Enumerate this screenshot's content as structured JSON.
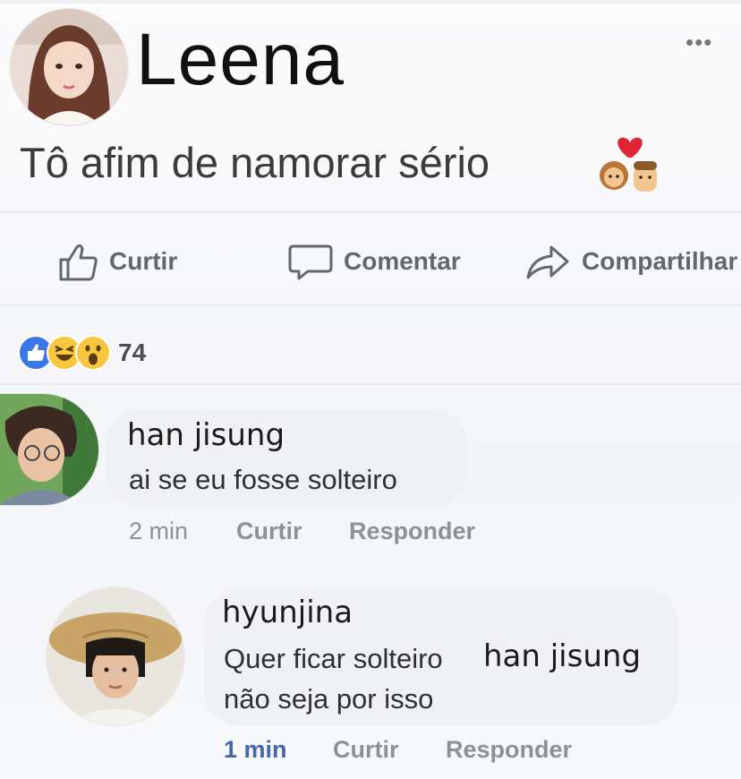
{
  "post": {
    "author_name": "Leena",
    "menu_icon": "more-options-icon",
    "menu_glyph": "•••",
    "text": "Tô afim de namorar sério",
    "emoji": "couple-with-heart"
  },
  "actions": {
    "like_label": "Curtir",
    "comment_label": "Comentar",
    "share_label": "Compartilhar"
  },
  "reactions": {
    "icons": [
      "like",
      "haha",
      "wow"
    ],
    "count": "74"
  },
  "comments": [
    {
      "author": "han jisung",
      "text": "ai se eu fosse solteiro",
      "time": "2 min",
      "like_label": "Curtir",
      "reply_label": "Responder"
    },
    {
      "author": "hyunjina",
      "text_line1": "Quer ficar solteiro",
      "mention": "han jisung",
      "text_line2": "não seja por isso",
      "time": "1 min",
      "like_label": "Curtir",
      "reply_label": "Responder"
    }
  ],
  "colors": {
    "action_text": "#64676b",
    "bubble": "#eff1f4",
    "link_blue": "#4867aa",
    "like_blue": "#3b78e7"
  }
}
